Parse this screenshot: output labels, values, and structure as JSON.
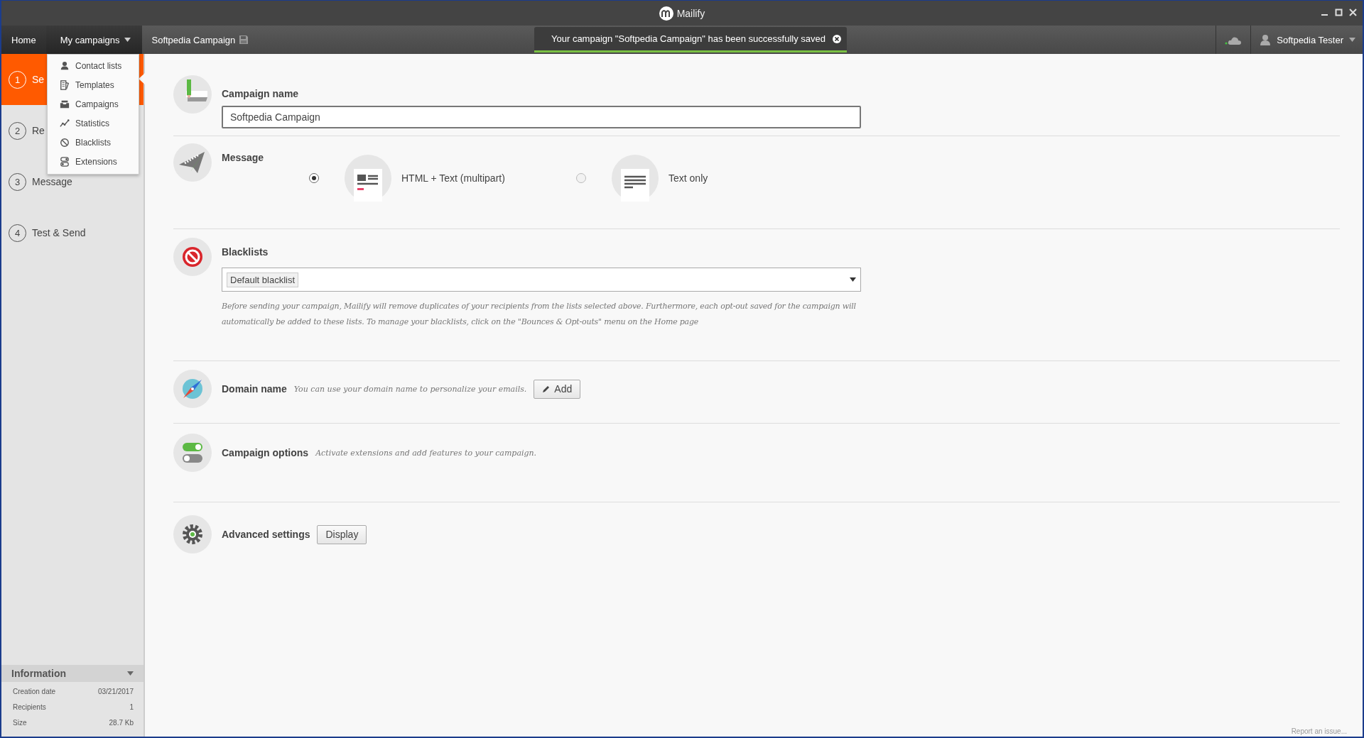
{
  "window": {
    "title": "Mailify"
  },
  "breadcrumbs": [
    {
      "label": "Home",
      "kind": "link"
    },
    {
      "label": "My campaigns",
      "kind": "menu",
      "expanded": true
    },
    {
      "label": "Softpedia Campaign",
      "kind": "current"
    }
  ],
  "notification": {
    "text": "Your campaign \"Softpedia Campaign\" has been successfully saved"
  },
  "user": {
    "name": "Softpedia Tester"
  },
  "menu": [
    {
      "label": "Contact lists"
    },
    {
      "label": "Templates"
    },
    {
      "label": "Campaigns"
    },
    {
      "label": "Statistics"
    },
    {
      "label": "Blacklists"
    },
    {
      "label": "Extensions"
    }
  ],
  "steps": [
    {
      "number": "1",
      "label": "Se",
      "selected": true
    },
    {
      "number": "2",
      "label": "Re",
      "selected": false
    },
    {
      "number": "3",
      "label": "Message",
      "selected": false
    },
    {
      "number": "4",
      "label": "Test & Send",
      "selected": false
    }
  ],
  "information": {
    "title": "Information",
    "rows": [
      {
        "label": "Creation date",
        "value": "03/21/2017"
      },
      {
        "label": "Recipients",
        "value": "1"
      },
      {
        "label": "Size",
        "value": "28.7 Kb"
      }
    ]
  },
  "sections": [
    {
      "kind": "name",
      "title": "Campaign name",
      "value": "Softpedia Campaign"
    },
    {
      "kind": "message",
      "title": "Message",
      "options": [
        {
          "label": "HTML + Text (multipart)",
          "selected": true
        },
        {
          "label": "Text only",
          "selected": false
        }
      ]
    },
    {
      "kind": "blacklists",
      "title": "Blacklists",
      "tag": "Default blacklist",
      "note": "Before sending your campaign, Mailify will remove duplicates of your recipients from the lists selected above.  Furthermore, each opt-out saved for the campaign will automatically be added to these lists.  To manage your blacklists, click on the \"Bounces & Opt-outs\" menu on the Home page"
    },
    {
      "kind": "domain",
      "title": "Domain name",
      "hint": "You can use your domain name to personalize your emails.",
      "button": "Add"
    },
    {
      "kind": "options",
      "title": "Campaign options",
      "hint": "Activate extensions and add features to your campaign."
    },
    {
      "kind": "advanced",
      "title": "Advanced settings",
      "button": "Display"
    }
  ],
  "footer": {
    "link": "Report an issue..."
  }
}
